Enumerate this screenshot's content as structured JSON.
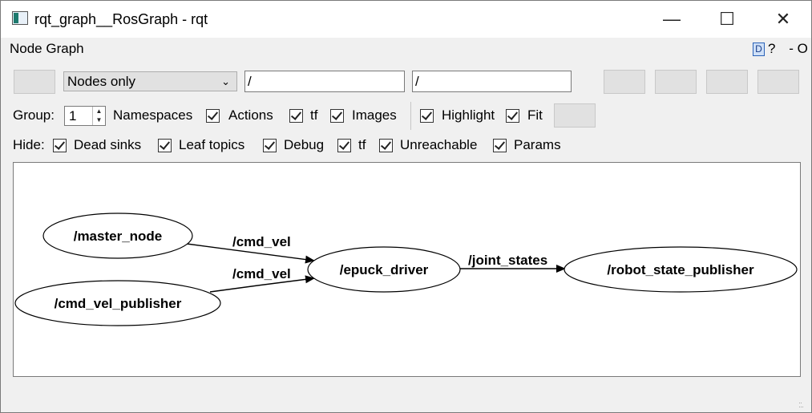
{
  "window": {
    "title": "rqt_graph__RosGraph - rqt",
    "minimize": "—",
    "maximize": "☐",
    "close": "✕"
  },
  "plugin": {
    "title": "Node Graph",
    "help": "?",
    "controls": "- O"
  },
  "toolbar": {
    "filter_mode": "Nodes only",
    "ns_filter": "/",
    "topic_filter": "/"
  },
  "options": {
    "group_label": "Group:",
    "group_value": "1",
    "namespaces": "Namespaces",
    "actions": "Actions",
    "tf": "tf",
    "images": "Images",
    "highlight": "Highlight",
    "fit": "Fit"
  },
  "hide": {
    "label": "Hide:",
    "dead_sinks": "Dead sinks",
    "leaf_topics": "Leaf topics",
    "debug": "Debug",
    "tf": "tf",
    "unreachable": "Unreachable",
    "params": "Params"
  },
  "graph": {
    "nodes": {
      "master": "/master_node",
      "cmdpub": "/cmd_vel_publisher",
      "epuck": "/epuck_driver",
      "rsp": "/robot_state_publisher"
    },
    "edges": {
      "cmd_vel_1": "/cmd_vel",
      "cmd_vel_2": "/cmd_vel",
      "joint_states": "/joint_states"
    }
  }
}
